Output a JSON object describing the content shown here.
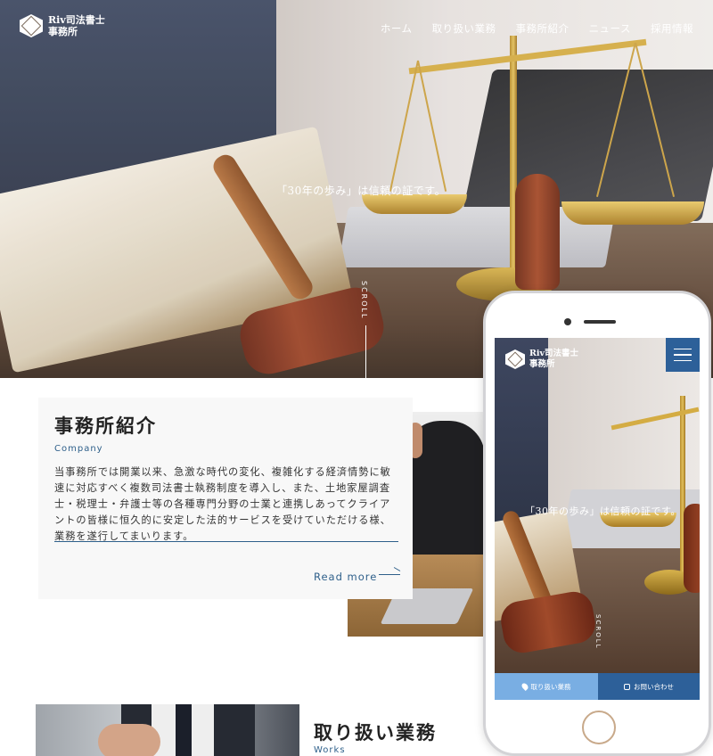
{
  "header": {
    "logo_line1": "Riv司法書士",
    "logo_line2": "事務所",
    "nav": [
      "ホーム",
      "取り扱い業務",
      "事務所紹介",
      "ニュース",
      "採用情報"
    ]
  },
  "hero": {
    "catch": "「30年の歩み」は信頼の証です。",
    "scroll": "SCROLL"
  },
  "company": {
    "title": "事務所紹介",
    "subtitle": "Company",
    "body": "当事務所では開業以来、急激な時代の変化、複雑化する経済情勢に敏速に対応すべく複数司法書士執務制度を導入し、また、土地家屋調査士・税理士・弁護士等の各種専門分野の士業と連携しあってクライアントの皆様に恒久的に安定した法的サービスを受けていただける様、業務を遂行してまいります。",
    "read_more": "Read more"
  },
  "works": {
    "title": "取り扱い業務",
    "subtitle": "Works"
  },
  "mobile": {
    "logo_line1": "Riv司法書士",
    "logo_line2": "事務所",
    "catch": "「30年の歩み」は信頼の証です。",
    "scroll": "SCROLL",
    "btn_services": "取り扱い業務",
    "btn_contact": "お問い合わせ"
  },
  "colors": {
    "accent": "#2e5f8a",
    "mobile_menu": "#2d6099",
    "mobile_btn_light": "#79aee3"
  }
}
